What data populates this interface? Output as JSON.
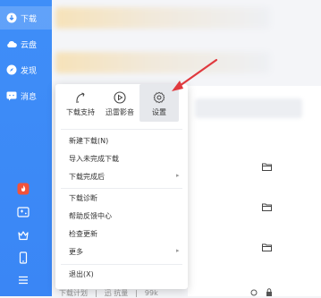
{
  "sidebar": {
    "items": [
      {
        "label": "下载",
        "icon": "download-icon",
        "active": true
      },
      {
        "label": "云盘",
        "icon": "cloud-icon",
        "active": false
      },
      {
        "label": "发现",
        "icon": "compass-icon",
        "active": false
      },
      {
        "label": "消息",
        "icon": "message-icon",
        "active": false
      }
    ],
    "bottom_icons": [
      "hot-icon",
      "game-icon",
      "crown-icon",
      "phone-icon",
      "menu-icon"
    ]
  },
  "toolbar": {
    "download_support": "下载支持",
    "xunlei_video": "迅雷影音",
    "settings": "设置"
  },
  "menu": {
    "new_download": "新建下载(N)",
    "import_unfinished": "导入未完成下载",
    "after_download": "下载完成后",
    "diagnose": "下载诊断",
    "help_feedback": "帮助反馈中心",
    "check_update": "检查更新",
    "more": "更多",
    "exit": "退出(X)"
  },
  "status": {
    "text": "下载计划　|　迅 抗量　|　99k"
  },
  "colors": {
    "sidebar": "#3f8ef8",
    "annotation_arrow": "#e0393e"
  }
}
